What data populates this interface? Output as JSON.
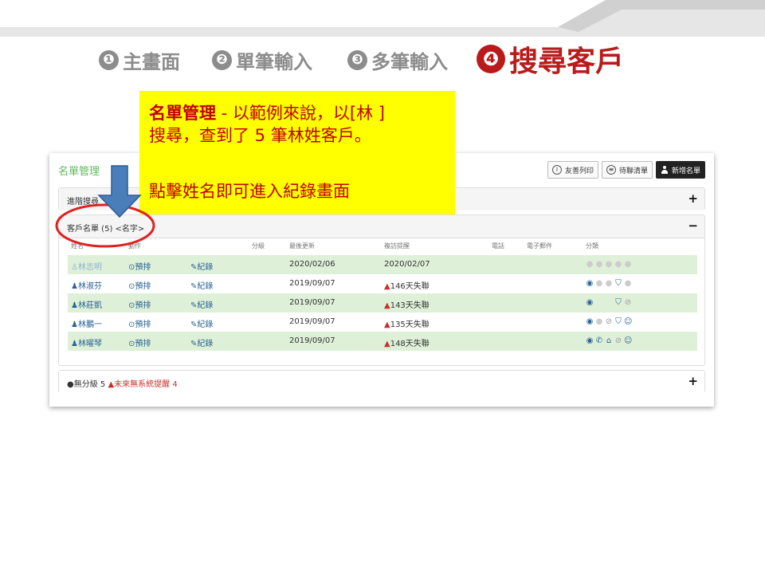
{
  "steps": [
    {
      "num": "❶",
      "label": "主畫面"
    },
    {
      "num": "❷",
      "label": "單筆輸入"
    },
    {
      "num": "❸",
      "label": "多筆輸入"
    },
    {
      "num": "❹",
      "label": "搜尋客戶"
    }
  ],
  "callout": {
    "heading": "名單管理",
    "line1": " - 以範例來說，以[林 ]",
    "line2": "搜尋，查到了 5 筆林姓客戶。",
    "line3": "點擊姓名即可進入紀錄畫面"
  },
  "panel": {
    "title": "名單管理",
    "buttons": {
      "print": "友善列印",
      "pending": "待聯清單",
      "new": "新增名單"
    },
    "advanced_search": "進階搜尋",
    "list_section": "客戶名單 (5) <名字>",
    "columns": [
      "姓名",
      "動作",
      "分級",
      "最後更新",
      "複訪提醒",
      "電話",
      "電子郵件",
      "分類"
    ],
    "rows": [
      {
        "name": "林志明",
        "action": "預排",
        "record": "紀錄",
        "updated": "2020/02/06",
        "reminder": "2020/02/07",
        "warn": false
      },
      {
        "name": "林淑芬",
        "action": "預排",
        "record": "紀錄",
        "updated": "2019/09/07",
        "reminder": "146天失聯",
        "warn": true
      },
      {
        "name": "林莊凱",
        "action": "預排",
        "record": "紀錄",
        "updated": "2019/09/07",
        "reminder": "143天失聯",
        "warn": true
      },
      {
        "name": "林鵬一",
        "action": "預排",
        "record": "紀錄",
        "updated": "2019/09/07",
        "reminder": "135天失聯",
        "warn": true
      },
      {
        "name": "林曜琴",
        "action": "預排",
        "record": "紀錄",
        "updated": "2019/09/07",
        "reminder": "148天失聯",
        "warn": true
      }
    ],
    "footer": {
      "ungraded": "●無分級 5",
      "no_reminder": "未來無系統提醒 4"
    }
  },
  "colors": {
    "accent": "#b91b1b",
    "highlight": "#ffff00",
    "row_green": "#dff0d8",
    "arrow": "#4a7ebb",
    "circle": "#e02020"
  }
}
